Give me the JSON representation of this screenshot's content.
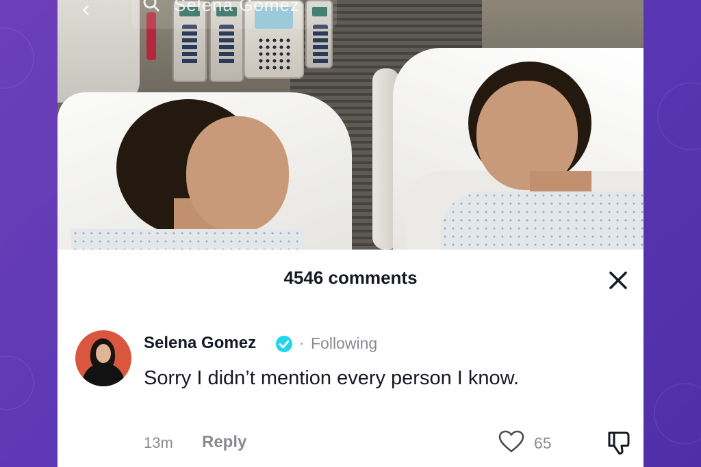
{
  "header": {
    "search_text": "Selena Gomez"
  },
  "comments_panel": {
    "title": "4546 comments"
  },
  "comment": {
    "username": "Selena Gomez",
    "follow_status": "Following",
    "separator": "·",
    "text": "Sorry I didn’t mention every person I know.",
    "time": "13m",
    "reply_label": "Reply",
    "like_count": "65"
  },
  "colors": {
    "background_purple": "#5b37b5",
    "verified_blue": "#20d5ec",
    "text_primary": "#161823",
    "text_secondary": "#8a8b91"
  },
  "icons": [
    "back-chevron-icon",
    "search-icon",
    "close-icon",
    "verified-badge-icon",
    "heart-icon",
    "dislike-icon"
  ]
}
